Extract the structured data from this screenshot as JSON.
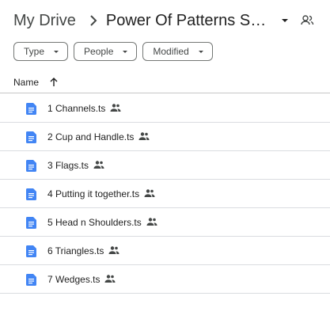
{
  "breadcrumb": {
    "root": "My Drive",
    "current": "Power Of Patterns Sunn...",
    "separator_icon": "chevron-right-icon",
    "menu_icon": "caret-down-icon",
    "shared_icon": "shared-folder-icon"
  },
  "filters": [
    {
      "label": "Type"
    },
    {
      "label": "People"
    },
    {
      "label": "Modified"
    }
  ],
  "list_header": {
    "name_label": "Name",
    "sort_icon": "arrow-up-icon"
  },
  "files": [
    {
      "name": "1 Channels.ts",
      "shared": true
    },
    {
      "name": "2 Cup and Handle.ts",
      "shared": true
    },
    {
      "name": "3 Flags.ts",
      "shared": true
    },
    {
      "name": "4 Putting it together.ts",
      "shared": true
    },
    {
      "name": "5 Head n Shoulders.ts",
      "shared": true
    },
    {
      "name": "6 Triangles.ts",
      "shared": true
    },
    {
      "name": "7 Wedges.ts",
      "shared": true
    }
  ],
  "colors": {
    "doc_icon_blue": "#4285f4",
    "text_primary": "#1f1f1f",
    "text_secondary": "#444746"
  }
}
